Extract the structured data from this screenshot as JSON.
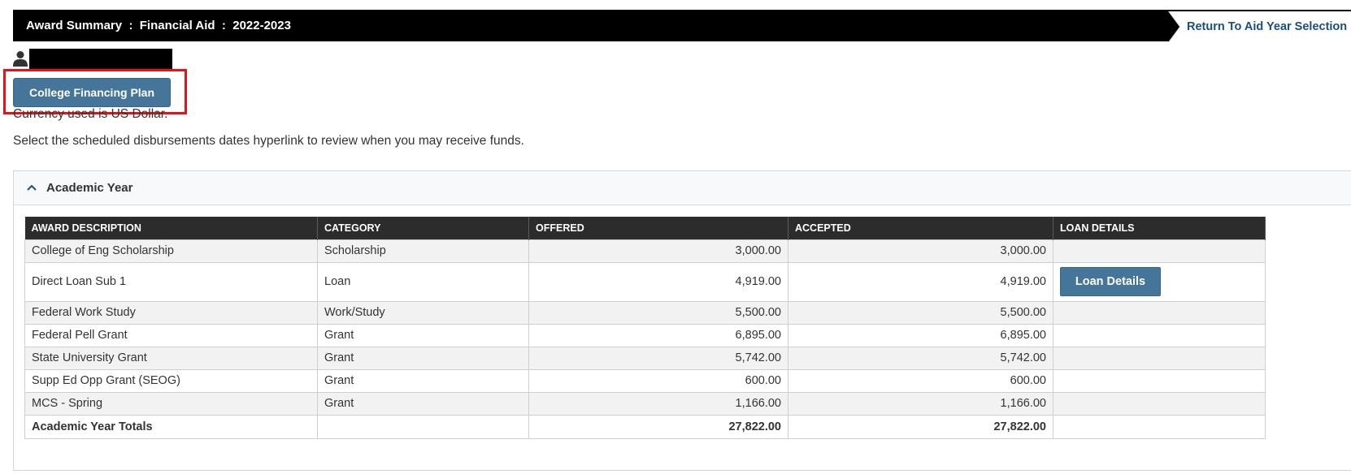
{
  "header": {
    "title": "Award Summary  :  Financial Aid  :  2022-2023",
    "return_link": "Return To Aid Year Selection"
  },
  "user": {
    "icon": "user-icon",
    "name_redacted": true
  },
  "buttons": {
    "college_financing_plan": "College Financing Plan"
  },
  "info": {
    "currency": "Currency used is US Dollar.",
    "instruction": "Select the scheduled disbursements dates hyperlink to review when you may receive funds."
  },
  "accordion": {
    "title": "Academic Year",
    "icon": "chevron-up-icon"
  },
  "table": {
    "columns": [
      "AWARD DESCRIPTION",
      "CATEGORY",
      "OFFERED",
      "ACCEPTED",
      "LOAN DETAILS"
    ],
    "rows": [
      {
        "description": "College of Eng Scholarship",
        "category": "Scholarship",
        "offered": "3,000.00",
        "accepted": "3,000.00",
        "loan_details": ""
      },
      {
        "description": "Direct Loan Sub 1",
        "category": "Loan",
        "offered": "4,919.00",
        "accepted": "4,919.00",
        "loan_details": "Loan Details"
      },
      {
        "description": "Federal Work Study",
        "category": "Work/Study",
        "offered": "5,500.00",
        "accepted": "5,500.00",
        "loan_details": ""
      },
      {
        "description": "Federal Pell Grant",
        "category": "Grant",
        "offered": "6,895.00",
        "accepted": "6,895.00",
        "loan_details": ""
      },
      {
        "description": "State University Grant",
        "category": "Grant",
        "offered": "5,742.00",
        "accepted": "5,742.00",
        "loan_details": ""
      },
      {
        "description": "Supp Ed Opp Grant (SEOG)",
        "category": "Grant",
        "offered": "600.00",
        "accepted": "600.00",
        "loan_details": ""
      },
      {
        "description": "MCS - Spring",
        "category": "Grant",
        "offered": "1,166.00",
        "accepted": "1,166.00",
        "loan_details": ""
      }
    ],
    "totals": {
      "label": "Academic Year Totals",
      "offered": "27,822.00",
      "accepted": "27,822.00"
    }
  },
  "colors": {
    "header_bg": "#000000",
    "button_bg": "#46759a",
    "highlight": "#e3121b",
    "link": "#1a4e80",
    "table_header_bg": "#2c2c2c"
  }
}
